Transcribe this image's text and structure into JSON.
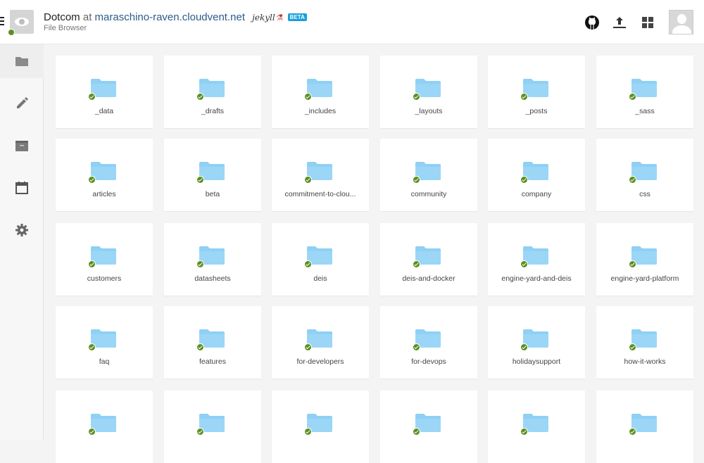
{
  "header": {
    "site_name": "Dotcom",
    "at_text": "at",
    "host": "maraschino-raven.cloudvent.net",
    "generator": "jekyll",
    "beta_label": "BETA",
    "subtitle": "File Browser"
  },
  "toolbar": {
    "icons": [
      "github-icon",
      "upload-icon",
      "apps-grid-icon"
    ],
    "avatar": "user-avatar"
  },
  "sidebar": {
    "items": [
      {
        "name": "files",
        "icon": "folder-icon",
        "active": true
      },
      {
        "name": "editor",
        "icon": "pencil-icon",
        "active": false
      },
      {
        "name": "collections",
        "icon": "archive-icon",
        "active": false
      },
      {
        "name": "schedule",
        "icon": "calendar-icon",
        "active": false
      },
      {
        "name": "settings",
        "icon": "gear-icon",
        "active": false
      }
    ]
  },
  "colors": {
    "folder": "#8fd0f5",
    "status_ok": "#5b8f1f",
    "accent": "#1a9fd9"
  },
  "folders": [
    "_data",
    "_drafts",
    "_includes",
    "_layouts",
    "_posts",
    "_sass",
    "articles",
    "beta",
    "commitment-to-clou...",
    "community",
    "company",
    "css",
    "customers",
    "datasheets",
    "deis",
    "deis-and-docker",
    "engine-yard-and-deis",
    "engine-yard-platform",
    "faq",
    "features",
    "for-developers",
    "for-devops",
    "holidaysupport",
    "how-it-works",
    "",
    "",
    "",
    "",
    "",
    ""
  ]
}
